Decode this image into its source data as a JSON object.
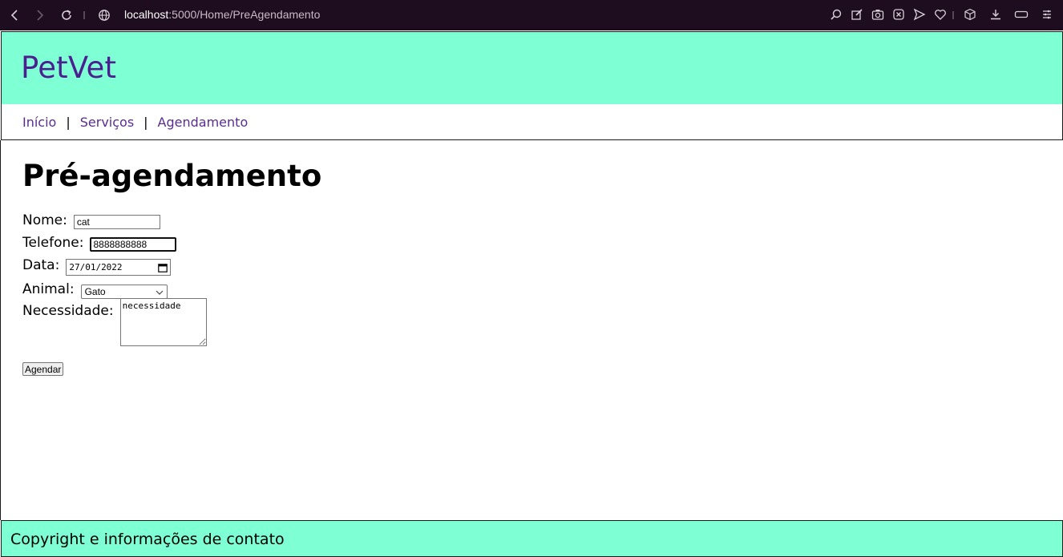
{
  "browser": {
    "url_host": "localhost",
    "url_rest": ":5000/Home/PreAgendamento",
    "icons": [
      "back-icon",
      "forward-icon",
      "reload-icon",
      "globe-icon",
      "zoom-icon",
      "edit-icon",
      "camera-icon",
      "close-x-icon",
      "send-icon",
      "heart-icon",
      "cube-icon",
      "download-icon",
      "battery-icon",
      "menu-icon"
    ]
  },
  "header": {
    "brand": "PetVet",
    "bg_color": "#7fffd4",
    "brand_color": "#4b1f8f"
  },
  "nav": {
    "links": [
      {
        "label": "Início"
      },
      {
        "label": "Serviços"
      },
      {
        "label": "Agendamento"
      }
    ],
    "separator": "|"
  },
  "page": {
    "title": "Pré-agendamento"
  },
  "form": {
    "nome_label": "Nome:",
    "nome_value": "cat",
    "telefone_label": "Telefone:",
    "telefone_value": "8888888888",
    "data_label": "Data:",
    "data_value": "27/01/2022",
    "animal_label": "Animal:",
    "animal_value": "Gato",
    "necessidade_label": "Necessidade:",
    "necessidade_value": "necessidade",
    "submit_label": "Agendar"
  },
  "footer": {
    "text": "Copyright e informações de contato"
  }
}
